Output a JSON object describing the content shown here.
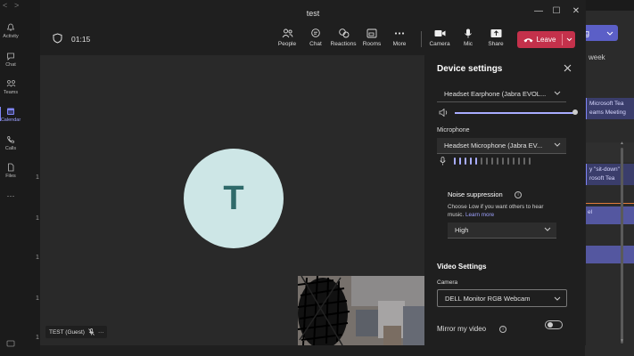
{
  "app": {
    "nav": [
      {
        "label": "Activity",
        "icon": "bell-icon"
      },
      {
        "label": "Chat",
        "icon": "chat-icon"
      },
      {
        "label": "Teams",
        "icon": "teams-icon"
      },
      {
        "label": "Calendar",
        "icon": "calendar-icon",
        "active": true
      },
      {
        "label": "Calls",
        "icon": "phone-icon"
      },
      {
        "label": "Files",
        "icon": "file-icon"
      }
    ],
    "more": "···",
    "row_numbers": [
      "1",
      "1",
      "1",
      "1",
      "1",
      "1"
    ],
    "join_label": "g",
    "week_label": "week",
    "events": [
      "Microsoft Tea",
      "eams Meeting",
      "y \"sit-down\"",
      "rosoft Tea",
      "el"
    ]
  },
  "meeting": {
    "title": "test",
    "timer": "01:15",
    "toolbar": [
      {
        "label": "People",
        "icon": "people-icon"
      },
      {
        "label": "Chat",
        "icon": "chat-icon"
      },
      {
        "label": "Reactions",
        "icon": "reactions-icon"
      },
      {
        "label": "Rooms",
        "icon": "rooms-icon"
      },
      {
        "label": "More",
        "icon": "more-icon"
      },
      {
        "label": "Camera",
        "icon": "camera-icon"
      },
      {
        "label": "Mic",
        "icon": "mic-icon"
      },
      {
        "label": "Share",
        "icon": "share-icon"
      }
    ],
    "leave_label": "Leave",
    "avatar_initial": "T",
    "participant_name": "TEST (Guest)"
  },
  "device_settings": {
    "title": "Device settings",
    "speaker": "Headset Earphone (Jabra EVOL...",
    "speaker_volume": 1.0,
    "microphone_label": "Microphone",
    "microphone": "Headset Microphone (Jabra EV...",
    "mic_level_active": 5,
    "mic_level_total": 15,
    "noise_title": "Noise suppression",
    "noise_desc": "Choose Low if you want others to hear music.",
    "noise_link": "Learn more",
    "noise_value": "High",
    "video_title": "Video Settings",
    "camera_label": "Camera",
    "camera": "DELL Monitor RGB Webcam",
    "mirror_label": "Mirror my video",
    "mirror_on": false
  },
  "colors": {
    "accent": "#5b5fc7",
    "leave": "#c4314b",
    "avatar_bg": "#cde6e6",
    "avatar_text": "#2f6a6a"
  }
}
